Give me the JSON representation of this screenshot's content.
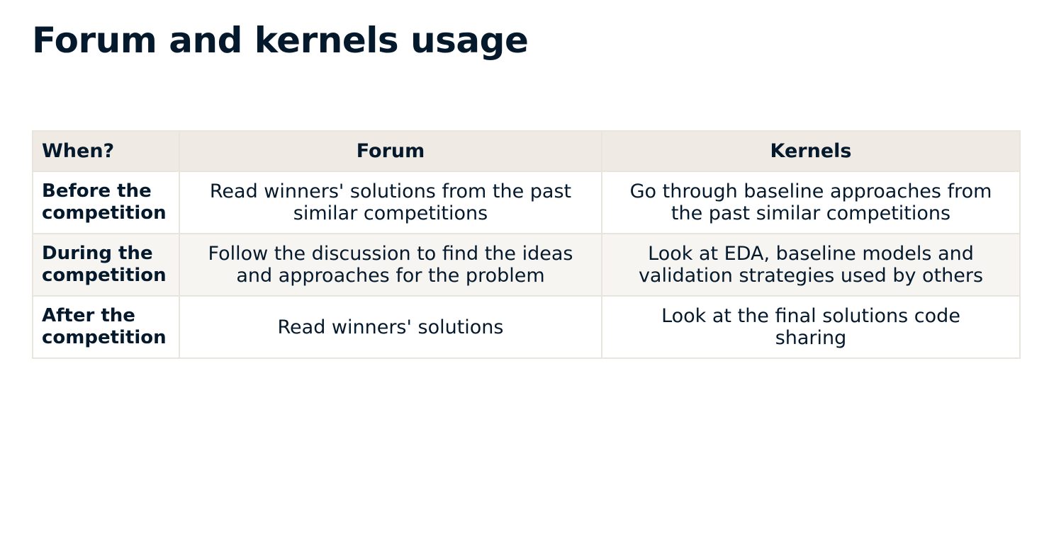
{
  "title": "Forum and kernels usage",
  "table": {
    "headers": [
      "When?",
      "Forum",
      "Kernels"
    ],
    "rows": [
      {
        "when": "Before the\ncompetition",
        "forum": "Read winners' solutions from the past\nsimilar competitions",
        "kernels": "Go through baseline approaches from\nthe past similar competitions"
      },
      {
        "when": "During the\ncompetition",
        "forum": "Follow the discussion to find the ideas\nand approaches for the problem",
        "kernels": "Look at EDA, baseline models and\nvalidation strategies used by others"
      },
      {
        "when": "After the\ncompetition",
        "forum": "Read winners' solutions",
        "kernels": "Look at the final solutions code\nsharing"
      }
    ]
  }
}
